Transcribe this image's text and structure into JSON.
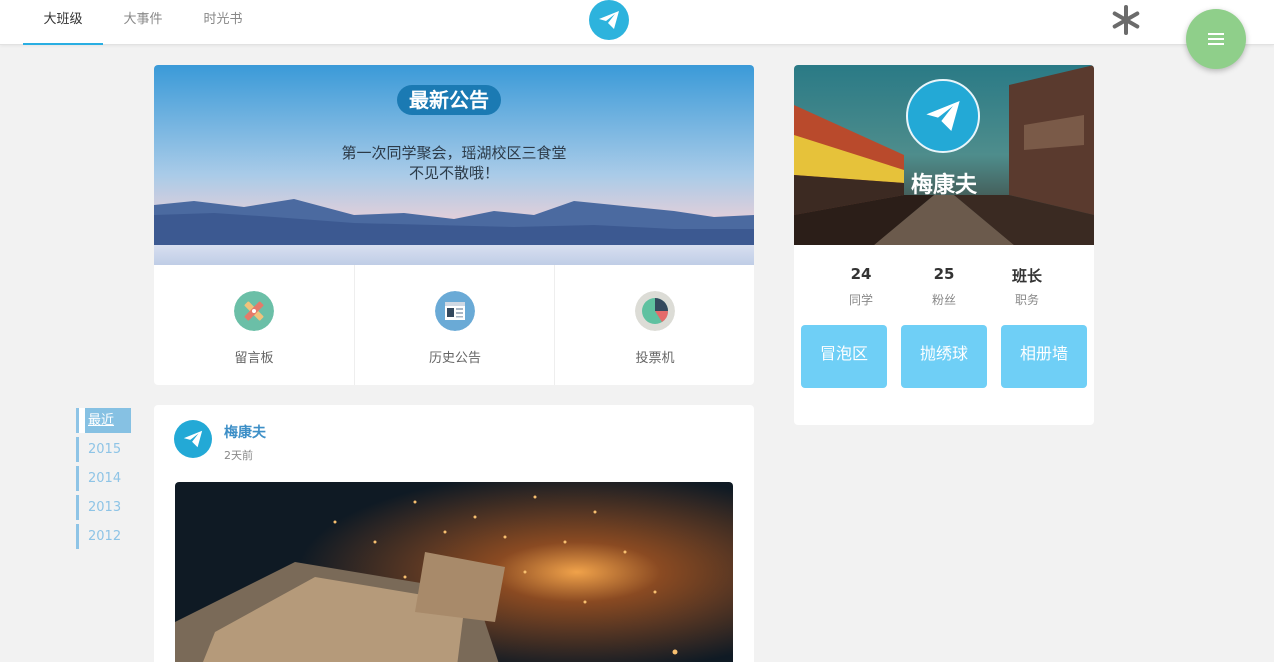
{
  "nav": {
    "tabs": [
      {
        "label": "大班级",
        "active": true
      },
      {
        "label": "大事件",
        "active": false
      },
      {
        "label": "时光书",
        "active": false
      }
    ],
    "accent_color": "#29aee2"
  },
  "notice": {
    "title": "最新公告",
    "line1": "第一次同学聚会，瑶湖校区三食堂",
    "line2": "不见不散哦！",
    "features": [
      {
        "label": "留言板",
        "icon": "pencil-ruler-icon"
      },
      {
        "label": "历史公告",
        "icon": "newspaper-icon"
      },
      {
        "label": "投票机",
        "icon": "pie-chart-icon"
      }
    ]
  },
  "profile": {
    "name": "梅康夫",
    "stats": [
      {
        "value": "24",
        "label": "同学"
      },
      {
        "value": "25",
        "label": "粉丝"
      },
      {
        "value": "班长",
        "label": "职务"
      }
    ],
    "buttons": [
      "冒泡区",
      "抛绣球",
      "相册墙"
    ],
    "button_color": "#6fcff6"
  },
  "years": [
    {
      "label": "最近",
      "active": true
    },
    {
      "label": "2015",
      "active": false
    },
    {
      "label": "2014",
      "active": false
    },
    {
      "label": "2013",
      "active": false
    },
    {
      "label": "2012",
      "active": false
    }
  ],
  "post": {
    "author": "梅康夫",
    "time": "2天前"
  }
}
